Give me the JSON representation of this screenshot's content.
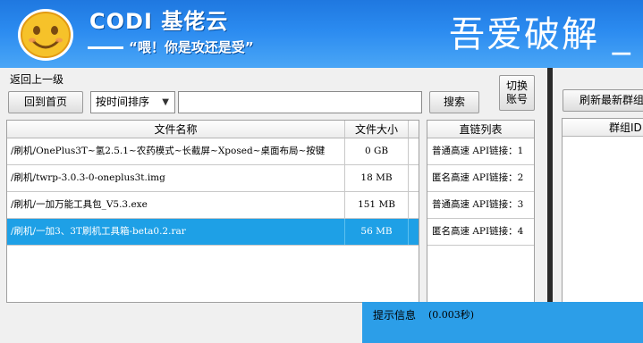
{
  "banner": {
    "brand_name": "CODI 基佬云",
    "slogan": "“喂！你是攻还是受”",
    "title": "吾爱破解 _"
  },
  "toolbar": {
    "back_label": "返回上一级",
    "home_label": "回到首页",
    "sort_value": "按时间排序",
    "search_value": "",
    "search_label": "搜索",
    "switch_label_1": "切换",
    "switch_label_2": "账号",
    "refresh_label": "刷新最新群组"
  },
  "file_table": {
    "headers": {
      "name": "文件名称",
      "size": "文件大小"
    },
    "rows": [
      {
        "name": "/刷机/OnePlus3T~氢2.5.1~农药模式~长截屏~Xposed~桌面布局~按键",
        "size": "0 GB"
      },
      {
        "name": "/刷机/twrp-3.0.3-0-oneplus3t.img",
        "size": "18 MB"
      },
      {
        "name": "/刷机/一加万能工具包_V5.3.exe",
        "size": "151 MB"
      },
      {
        "name": "/刷机/一加3、3T刷机工具箱-beta0.2.rar",
        "size": "56 MB"
      }
    ],
    "selected_index": 3
  },
  "link_list": {
    "header": "直链列表",
    "items": [
      "普通高速 API链接：1",
      "匿名高速 API链接：2",
      "普通高速 API链接：3",
      "匿名高速 API链接：4"
    ]
  },
  "group_table": {
    "header": "群组ID"
  },
  "status": {
    "label": "提示信息",
    "time": "(0.003秒)"
  },
  "colors": {
    "banner": "#2b8bf0",
    "selection": "#1ea0e6",
    "status_bar": "#2c9ee8"
  }
}
